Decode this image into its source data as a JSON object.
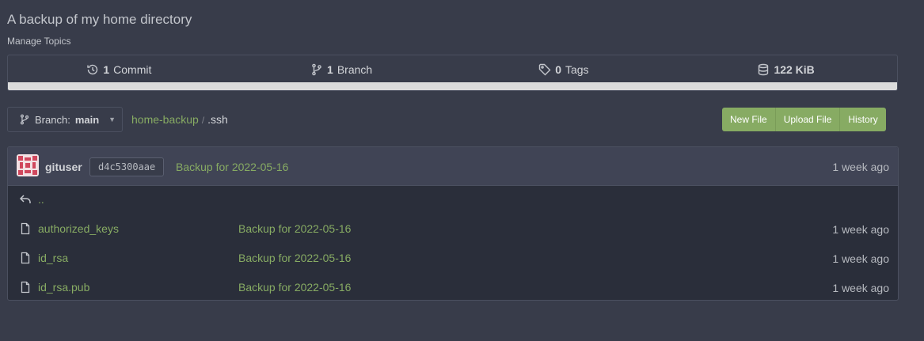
{
  "repo": {
    "description": "A backup of my home directory",
    "manage_topics": "Manage Topics"
  },
  "stats": {
    "commits": {
      "count": "1",
      "label": "Commit",
      "icon": "history-icon"
    },
    "branches": {
      "count": "1",
      "label": "Branch",
      "icon": "branch-icon"
    },
    "tags": {
      "count": "0",
      "label": "Tags",
      "icon": "tag-icon"
    },
    "size": {
      "value": "122 KiB",
      "icon": "database-icon"
    }
  },
  "branch_selector": {
    "prefix": "Branch:",
    "name": "main"
  },
  "breadcrumb": {
    "repo": "home-backup",
    "separator": "/",
    "current": ".ssh"
  },
  "actions": {
    "new_file": "New File",
    "upload_file": "Upload File",
    "history": "History"
  },
  "latest_commit": {
    "user": "gituser",
    "sha": "d4c5300aae",
    "message": "Backup for 2022-05-16",
    "time": "1 week ago"
  },
  "parent_dir": "..",
  "files": [
    {
      "name": "authorized_keys",
      "message": "Backup for 2022-05-16",
      "time": "1 week ago"
    },
    {
      "name": "id_rsa",
      "message": "Backup for 2022-05-16",
      "time": "1 week ago"
    },
    {
      "name": "id_rsa.pub",
      "message": "Backup for 2022-05-16",
      "time": "1 week ago"
    }
  ],
  "colors": {
    "accent": "#87ab63",
    "background": "#383c4a",
    "panel": "#2a2e3a"
  }
}
